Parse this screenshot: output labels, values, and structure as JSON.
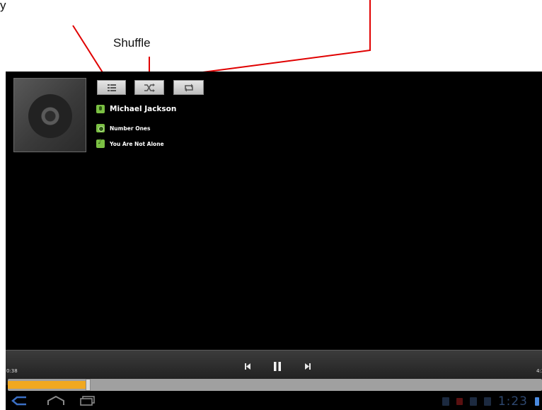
{
  "annotations": {
    "partial_label": "y",
    "shuffle_label": "Shuffle",
    "line_color": "#e00000"
  },
  "now_playing": {
    "artist": "Michael Jackson",
    "album": "Number Ones",
    "song": "You Are Not Alone"
  },
  "controls": {
    "queue_icon": "list-icon",
    "shuffle_icon": "shuffle-icon",
    "repeat_icon": "repeat-icon"
  },
  "playback": {
    "elapsed": "0:38",
    "total": "4:3",
    "progress_fraction": 0.148,
    "accent_color": "#f0a820",
    "state": "playing",
    "transport_icons": [
      "previous-icon",
      "pause-icon",
      "next-icon"
    ]
  },
  "system_bar": {
    "clock": "1:23",
    "nav_icons": [
      "back-icon",
      "home-icon",
      "recent-apps-icon"
    ]
  }
}
